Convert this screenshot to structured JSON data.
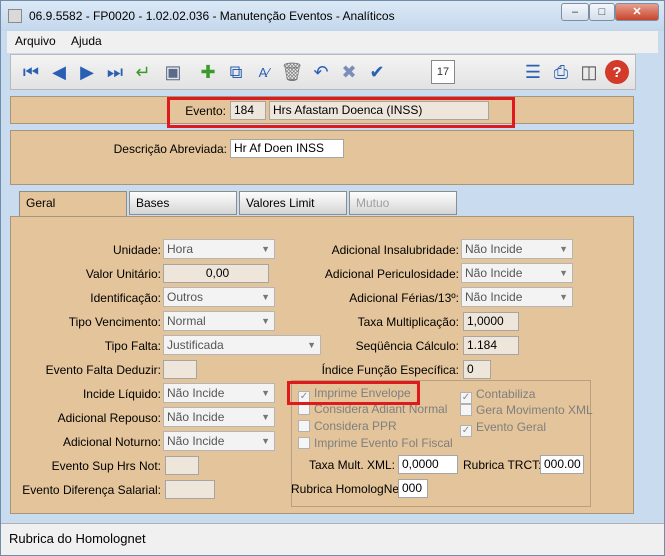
{
  "window": {
    "title": "06.9.5582 - FP0020 - 1.02.02.036 - Manutenção Eventos - Analíticos"
  },
  "menu": {
    "arquivo": "Arquivo",
    "ajuda": "Ajuda"
  },
  "evento": {
    "label": "Evento:",
    "code": "184",
    "name": "Hrs Afastam Doenca   (INSS)"
  },
  "descricao": {
    "label": "Descrição Abreviada:",
    "value": "Hr Af Doen INSS"
  },
  "tabs": [
    "Geral",
    "Bases",
    "Valores Limit",
    "Mutuo"
  ],
  "left": {
    "unidade": {
      "label": "Unidade:",
      "value": "Hora"
    },
    "valor_unitario": {
      "label": "Valor Unitário:",
      "value": "0,00"
    },
    "identificacao": {
      "label": "Identificação:",
      "value": "Outros"
    },
    "tipo_vencimento": {
      "label": "Tipo Vencimento:",
      "value": "Normal"
    },
    "tipo_falta": {
      "label": "Tipo Falta:",
      "value": "Justificada"
    },
    "evento_falta_deduzir": {
      "label": "Evento Falta Deduzir:",
      "value": ""
    },
    "incide_liquido": {
      "label": "Incide Líquido:",
      "value": "Não Incide"
    },
    "adicional_repouso": {
      "label": "Adicional Repouso:",
      "value": "Não Incide"
    },
    "adicional_noturno": {
      "label": "Adicional Noturno:",
      "value": "Não Incide"
    },
    "evento_sup_hrs": {
      "label": "Evento Sup Hrs Not:",
      "value": ""
    },
    "evento_diferenca": {
      "label": "Evento Diferença Salarial:",
      "value": ""
    }
  },
  "right": {
    "adicional_insalubridade": {
      "label": "Adicional Insalubridade:",
      "value": "Não Incide"
    },
    "adicional_periculosidade": {
      "label": "Adicional Periculosidade:",
      "value": "Não Incide"
    },
    "adicional_ferias": {
      "label": "Adicional Férias/13º:",
      "value": "Não Incide"
    },
    "taxa_multiplicacao": {
      "label": "Taxa Multiplicação:",
      "value": "1,0000"
    },
    "sequencia_calculo": {
      "label": "Seqüência Cálculo:",
      "value": "1.184"
    },
    "indice_funcao": {
      "label": "Índice Função Específica:",
      "value": "0"
    }
  },
  "checks": {
    "imprime_envelope": {
      "label": "Imprime Envelope",
      "checked": true
    },
    "considera_adiant": {
      "label": "Considera Adiant Normal",
      "checked": false
    },
    "considera_ppr": {
      "label": "Considera PPR",
      "checked": false
    },
    "imprime_evento_fol": {
      "label": "Imprime Evento Fol Fiscal",
      "checked": false
    },
    "contabiliza": {
      "label": "Contabiliza",
      "checked": true
    },
    "gera_movimento": {
      "label": "Gera Movimento XML",
      "checked": false
    },
    "evento_geral": {
      "label": "Evento Geral",
      "checked": true
    }
  },
  "xml": {
    "taxa_mult_label": "Taxa Mult. XML:",
    "taxa_mult_value": "0,0000",
    "rubrica_trct_label": "Rubrica TRCT:",
    "rubrica_trct_value": "000.00",
    "rubrica_homolog_label": "Rubrica HomologNet:",
    "rubrica_homolog_value": "000"
  },
  "status": {
    "text": "Rubrica do Homolognet"
  },
  "colors": {
    "panel": "#e4c49a",
    "highlight": "#e0191c",
    "toolbar_icon": "#2a5fb4"
  },
  "icons": [
    "first-icon",
    "prev-icon",
    "next-icon",
    "last-icon",
    "return-icon",
    "preview-icon",
    "new-icon",
    "copy-icon",
    "edit-icon",
    "delete-icon",
    "undo-icon",
    "cancel-icon",
    "confirm-icon",
    "calendar-icon",
    "tree-icon",
    "print-icon",
    "exit-icon",
    "help-icon"
  ],
  "calendar_day": "17"
}
